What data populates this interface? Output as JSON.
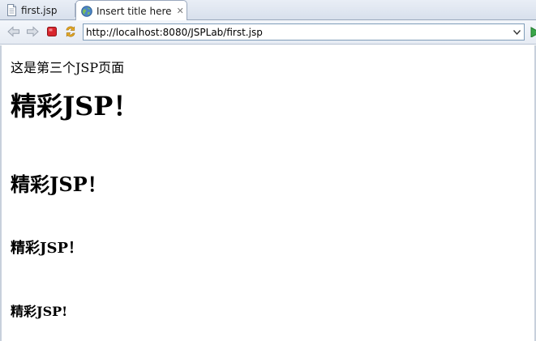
{
  "tabs": [
    {
      "label": "first.jsp",
      "icon": "jsp-file-icon",
      "active": false
    },
    {
      "label": "Insert title here",
      "icon": "globe-icon",
      "active": true
    }
  ],
  "toolbar": {
    "url": "http://localhost:8080/JSPLab/first.jsp"
  },
  "page": {
    "paragraph": "这是第三个JSP页面",
    "h1": "精彩JSP！",
    "h2": "精彩JSP！",
    "h3": "精彩JSP！",
    "h4": "精彩JSP!"
  }
}
